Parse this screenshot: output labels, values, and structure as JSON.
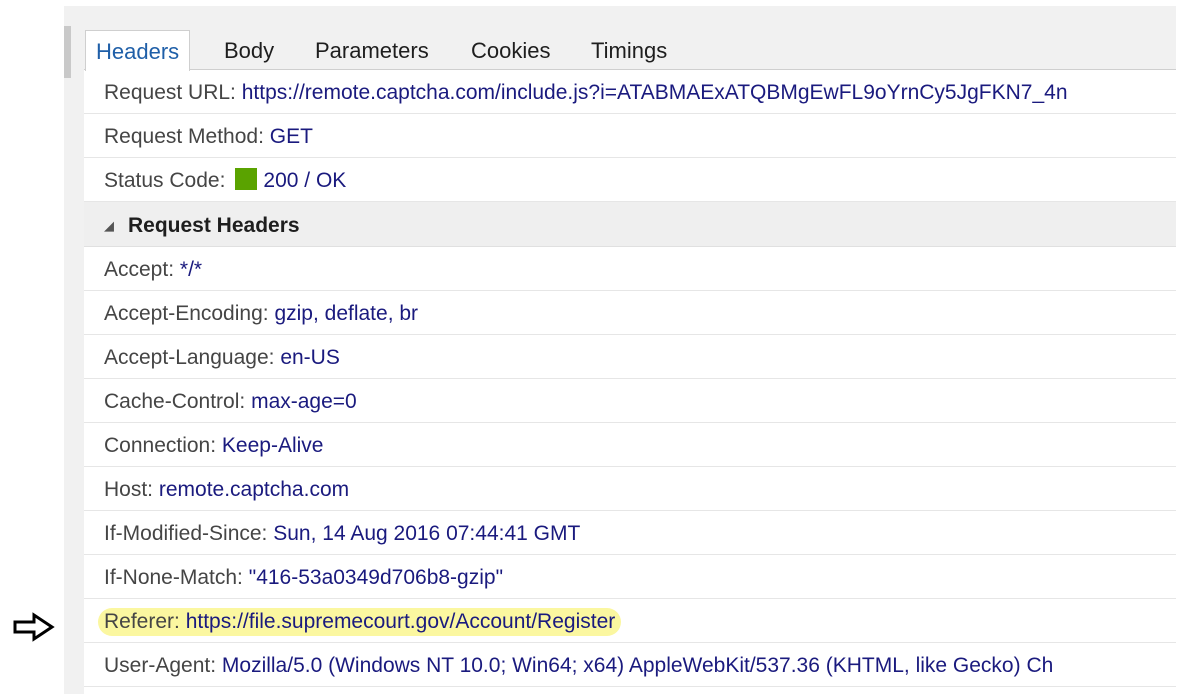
{
  "tabs": [
    {
      "label": "Headers",
      "active": true
    },
    {
      "label": "Body",
      "active": false
    },
    {
      "label": "Parameters",
      "active": false
    },
    {
      "label": "Cookies",
      "active": false
    },
    {
      "label": "Timings",
      "active": false
    }
  ],
  "general": {
    "request_url": {
      "key": "Request URL:",
      "value": "https://remote.captcha.com/include.js?i=ATABMAExATQBMgEwFL9oYrnCy5JgFKN7_4n"
    },
    "request_method": {
      "key": "Request Method:",
      "value": "GET"
    },
    "status_code": {
      "key": "Status Code:",
      "value": "200 / OK",
      "color": "#5aa300"
    }
  },
  "request_headers": {
    "title": "Request Headers",
    "items": [
      {
        "key": "Accept:",
        "value": "*/*"
      },
      {
        "key": "Accept-Encoding:",
        "value": "gzip, deflate, br"
      },
      {
        "key": "Accept-Language:",
        "value": "en-US"
      },
      {
        "key": "Cache-Control:",
        "value": "max-age=0"
      },
      {
        "key": "Connection:",
        "value": "Keep-Alive"
      },
      {
        "key": "Host:",
        "value": "remote.captcha.com"
      },
      {
        "key": "If-Modified-Since:",
        "value": "Sun, 14 Aug 2016 07:44:41 GMT"
      },
      {
        "key": "If-None-Match:",
        "value": "\"416-53a0349d706b8-gzip\""
      },
      {
        "key": "Referer:",
        "value": "https://file.supremecourt.gov/Account/Register",
        "highlighted": true
      },
      {
        "key": "User-Agent:",
        "value": "Mozilla/5.0 (Windows NT 10.0; Win64; x64) AppleWebKit/537.36 (KHTML, like Gecko) Ch"
      }
    ]
  },
  "annotation": {
    "icon": "right-arrow-icon",
    "highlight_color": "#fbf7a0"
  }
}
